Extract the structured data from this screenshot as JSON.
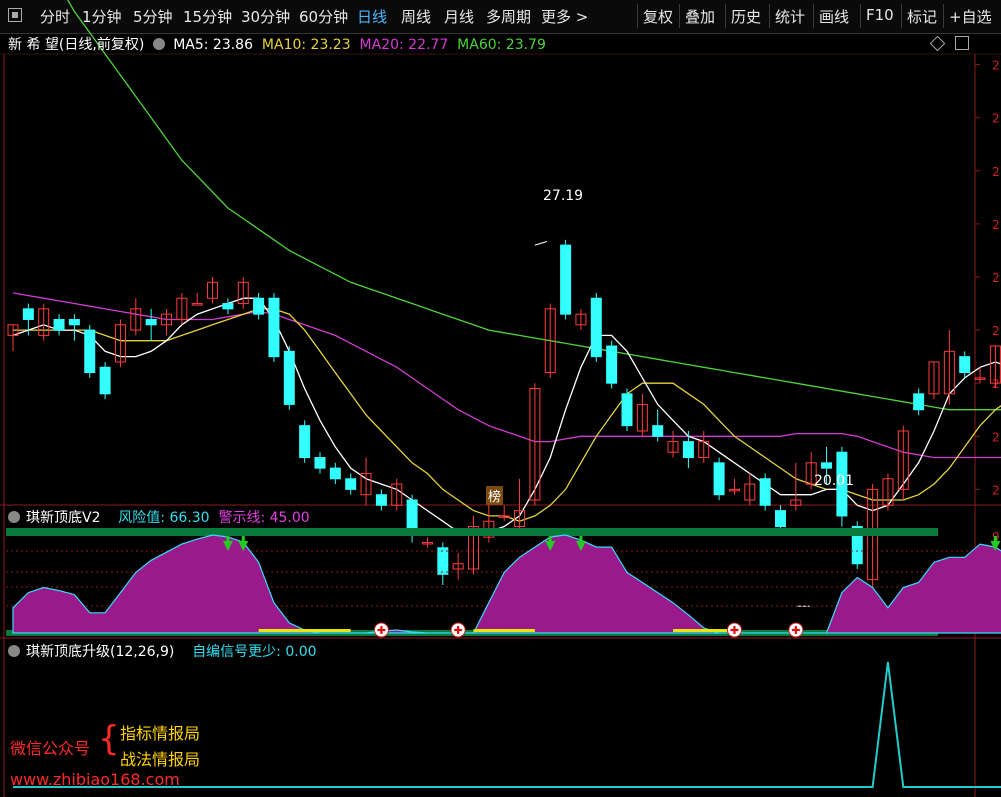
{
  "toolbar": {
    "left": [
      "分时",
      "1分钟",
      "5分钟",
      "15分钟",
      "30分钟",
      "60分钟",
      "日线",
      "周线",
      "月线",
      "多周期",
      "更多 >"
    ],
    "active": "日线",
    "right": [
      "复权",
      "叠加",
      "历史",
      "统计",
      "画线",
      "F10",
      "标记",
      "+自选"
    ]
  },
  "main_panel": {
    "stock": "新 希 望",
    "period": "(日线,前复权)",
    "ma5": "MA5: 23.86",
    "ma10": "MA10: 23.23",
    "ma20": "MA20: 22.77",
    "ma60": "MA60: 23.79",
    "high_label": "27.19",
    "low_label": "20.01",
    "badge": "榜"
  },
  "ind1": {
    "name": "琪新顶底V2",
    "risk": "风险值: 66.30",
    "warn": "警示线: 45.00"
  },
  "ind2": {
    "name": "琪新顶底升级(12,26,9)",
    "signal": "自编信号更少: 0.00"
  },
  "watermark": {
    "wechat": "微信公众号",
    "line1": "指标情报局",
    "line2": "战法情报局",
    "url": "www.zhibiao168.com"
  },
  "colors": {
    "up": "#ff3c3c",
    "down": "#33ffff",
    "ma5": "#ffffff",
    "ma10": "#e6d23c",
    "ma20": "#d23cd2",
    "ma60": "#50d23c",
    "area": "#9a1a8c",
    "band": "#0a7a3a"
  },
  "chart_data": [
    {
      "type": "candlestick",
      "title": "新 希 望",
      "ylim": [
        19.8,
        28.2
      ],
      "candles": [
        [
          22.9,
          23.1,
          22.6,
          22.8
        ],
        [
          23.4,
          23.2,
          23.5,
          22.9
        ],
        [
          22.9,
          23.4,
          22.8,
          23.5
        ],
        [
          23.2,
          23.0,
          23.3,
          22.9
        ],
        [
          23.2,
          23.1,
          23.3,
          22.8
        ],
        [
          23.0,
          22.2,
          23.1,
          22.1
        ],
        [
          22.3,
          21.8,
          22.4,
          21.7
        ],
        [
          22.4,
          23.1,
          22.3,
          23.2
        ],
        [
          23.0,
          23.4,
          22.9,
          23.6
        ],
        [
          23.2,
          23.1,
          23.4,
          22.8
        ],
        [
          23.1,
          23.3,
          22.9,
          23.4
        ],
        [
          23.2,
          23.6,
          23.1,
          23.7
        ],
        [
          23.5,
          23.5,
          23.5,
          23.7
        ],
        [
          23.6,
          23.9,
          23.5,
          24.0
        ],
        [
          23.5,
          23.4,
          23.6,
          23.3
        ],
        [
          23.5,
          23.9,
          23.4,
          24.0
        ],
        [
          23.6,
          23.3,
          23.7,
          23.2
        ],
        [
          23.6,
          22.5,
          23.7,
          22.4
        ],
        [
          22.6,
          21.6,
          22.7,
          21.5
        ],
        [
          21.2,
          20.6,
          21.3,
          20.5
        ],
        [
          20.6,
          20.4,
          20.7,
          20.3
        ],
        [
          20.4,
          20.2,
          20.5,
          20.1
        ],
        [
          20.2,
          20.0,
          20.3,
          19.9
        ],
        [
          19.9,
          20.3,
          19.7,
          20.6
        ],
        [
          19.9,
          19.7,
          20.0,
          19.6
        ],
        [
          19.7,
          20.1,
          19.6,
          20.2
        ],
        [
          19.8,
          19.2,
          19.9,
          19.0
        ],
        [
          19.0,
          19.0,
          19.1,
          18.9
        ],
        [
          18.9,
          18.4,
          19.0,
          18.2
        ],
        [
          18.5,
          18.6,
          18.3,
          18.8
        ],
        [
          18.5,
          19.3,
          18.4,
          19.5
        ],
        [
          19.1,
          19.4,
          19.0,
          19.8
        ],
        [
          19.5,
          19.5,
          19.4,
          19.7
        ],
        [
          19.3,
          19.6,
          19.2,
          20.2
        ],
        [
          19.8,
          21.9,
          19.7,
          22.0
        ],
        [
          22.2,
          23.4,
          22.1,
          23.5
        ],
        [
          24.6,
          23.3,
          24.7,
          23.2
        ],
        [
          23.1,
          23.3,
          23.0,
          23.4
        ],
        [
          23.6,
          22.5,
          23.7,
          22.4
        ],
        [
          22.7,
          22.0,
          22.8,
          21.9
        ],
        [
          21.8,
          21.2,
          21.9,
          21.1
        ],
        [
          21.1,
          21.6,
          21.0,
          21.8
        ],
        [
          21.2,
          21.0,
          21.5,
          20.9
        ],
        [
          20.7,
          20.9,
          20.6,
          21.1
        ],
        [
          20.9,
          20.6,
          21.1,
          20.4
        ],
        [
          20.6,
          20.9,
          20.5,
          21.1
        ],
        [
          20.5,
          19.9,
          20.6,
          19.8
        ],
        [
          20.0,
          20.0,
          20.2,
          19.9
        ],
        [
          19.8,
          20.1,
          19.7,
          20.3
        ],
        [
          20.2,
          19.7,
          20.3,
          19.6
        ],
        [
          19.6,
          19.3,
          19.7,
          19.2
        ],
        [
          19.7,
          19.8,
          19.6,
          20.5
        ],
        [
          20.1,
          20.5,
          20.0,
          20.7
        ],
        [
          20.5,
          20.4,
          20.8,
          20.1
        ],
        [
          20.7,
          19.5,
          20.8,
          19.3
        ],
        [
          19.3,
          18.6,
          19.4,
          18.5
        ],
        [
          18.3,
          20.0,
          17.8,
          20.1
        ],
        [
          19.7,
          20.2,
          19.6,
          20.3
        ],
        [
          20.0,
          21.1,
          19.8,
          21.2
        ],
        [
          21.8,
          21.5,
          21.9,
          21.4
        ],
        [
          21.8,
          22.4,
          21.7,
          22.4
        ],
        [
          21.8,
          22.6,
          21.6,
          23.0
        ],
        [
          22.5,
          22.2,
          22.6,
          22.1
        ],
        [
          22.1,
          22.1,
          22.0,
          22.3
        ],
        [
          22.0,
          22.7,
          21.9,
          22.7
        ],
        [
          22.6,
          21.8,
          22.7,
          21.7
        ]
      ],
      "ma5_line": [
        22.9,
        23.0,
        23.1,
        23.0,
        23.0,
        22.9,
        22.6,
        22.5,
        22.5,
        22.6,
        22.8,
        23.1,
        23.3,
        23.4,
        23.5,
        23.6,
        23.6,
        23.2,
        22.6,
        21.9,
        21.3,
        20.8,
        20.4,
        20.2,
        20.1,
        20.0,
        19.8,
        19.6,
        19.4,
        19.2,
        19.2,
        19.2,
        19.3,
        19.5,
        20.0,
        20.6,
        21.5,
        22.3,
        22.9,
        22.9,
        22.6,
        22.1,
        21.6,
        21.3,
        21.0,
        20.9,
        20.7,
        20.5,
        20.3,
        20.1,
        19.9,
        19.9,
        19.9,
        20.0,
        20.0,
        19.7,
        19.6,
        19.7,
        20.1,
        20.5,
        21.1,
        21.8,
        22.1,
        22.3,
        22.4,
        22.3
      ],
      "ma10_line": [
        23.0,
        23.0,
        23.0,
        23.0,
        23.0,
        23.0,
        22.9,
        22.8,
        22.8,
        22.8,
        22.8,
        22.9,
        23.0,
        23.1,
        23.2,
        23.3,
        23.4,
        23.4,
        23.3,
        23.0,
        22.6,
        22.2,
        21.8,
        21.4,
        21.1,
        20.8,
        20.5,
        20.3,
        20.0,
        19.8,
        19.6,
        19.5,
        19.5,
        19.4,
        19.5,
        19.7,
        20.0,
        20.5,
        21.0,
        21.4,
        21.8,
        22.0,
        22.0,
        22.0,
        21.8,
        21.6,
        21.3,
        21.0,
        20.8,
        20.6,
        20.4,
        20.2,
        20.1,
        20.0,
        20.0,
        19.9,
        19.8,
        19.8,
        19.8,
        19.9,
        20.1,
        20.4,
        20.8,
        21.2,
        21.5,
        21.7
      ],
      "ma20_line": [
        23.7,
        23.65,
        23.6,
        23.55,
        23.5,
        23.45,
        23.4,
        23.35,
        23.3,
        23.25,
        23.2,
        23.2,
        23.2,
        23.2,
        23.25,
        23.3,
        23.35,
        23.3,
        23.2,
        23.1,
        23.0,
        22.9,
        22.75,
        22.6,
        22.45,
        22.3,
        22.1,
        21.9,
        21.7,
        21.5,
        21.35,
        21.2,
        21.1,
        21.0,
        20.9,
        20.9,
        20.95,
        21.0,
        21.0,
        21.0,
        21.0,
        21.0,
        21.0,
        21.0,
        21.0,
        21.0,
        21.0,
        21.0,
        21.0,
        21.0,
        21.0,
        21.05,
        21.05,
        21.05,
        21.05,
        21.0,
        20.9,
        20.8,
        20.7,
        20.65,
        20.6,
        20.6,
        20.6,
        20.6,
        20.6,
        20.6
      ],
      "ma60_line": [
        31.0,
        30.5,
        30.0,
        29.5,
        29.0,
        28.6,
        28.2,
        27.8,
        27.4,
        27.0,
        26.6,
        26.2,
        25.9,
        25.6,
        25.3,
        25.1,
        24.9,
        24.7,
        24.5,
        24.35,
        24.2,
        24.05,
        23.9,
        23.8,
        23.7,
        23.6,
        23.5,
        23.4,
        23.3,
        23.2,
        23.1,
        23.0,
        22.95,
        22.9,
        22.85,
        22.8,
        22.75,
        22.7,
        22.65,
        22.6,
        22.55,
        22.5,
        22.45,
        22.4,
        22.35,
        22.3,
        22.25,
        22.2,
        22.15,
        22.1,
        22.05,
        22.0,
        21.95,
        21.9,
        21.85,
        21.8,
        21.75,
        21.7,
        21.65,
        21.6,
        21.55,
        21.5,
        21.5,
        21.5,
        21.5,
        21.5
      ]
    },
    {
      "type": "area",
      "title": "琪新顶底V2",
      "ylim": [
        0,
        10
      ],
      "warn_line": 4.5,
      "values": [
        2.5,
        4.0,
        4.5,
        4.2,
        3.8,
        2.0,
        2.0,
        4.0,
        6.0,
        7.2,
        8.0,
        8.8,
        9.3,
        9.7,
        9.5,
        9.0,
        7.0,
        3.0,
        1.0,
        0.3,
        0.0,
        0.0,
        0.0,
        0.0,
        0.2,
        0.3,
        0.1,
        0.0,
        0.0,
        0.0,
        0.0,
        3.0,
        6.0,
        7.5,
        8.5,
        9.5,
        9.7,
        9.2,
        8.5,
        8.5,
        6.0,
        5.0,
        4.0,
        3.0,
        1.8,
        0.5,
        0.0,
        0.0,
        0.0,
        0.0,
        0.0,
        0.0,
        0.0,
        0.0,
        4.0,
        5.5,
        4.5,
        2.5,
        4.5,
        5.0,
        7.0,
        7.5,
        7.5,
        8.8,
        8.5,
        7.5
      ],
      "top_signals": [
        14,
        15,
        35,
        37,
        64
      ],
      "bottom_signals": [
        24,
        29,
        47,
        51
      ]
    },
    {
      "type": "line",
      "title": "琪新顶底升级(12,26,9)",
      "ylim": [
        0,
        1
      ],
      "values": [
        0,
        0,
        0,
        0,
        0,
        0,
        0,
        0,
        0,
        0,
        0,
        0,
        0,
        0,
        0,
        0,
        0,
        0,
        0,
        0,
        0,
        0,
        0,
        0,
        0,
        0,
        0,
        0,
        0,
        0,
        0,
        0,
        0,
        0,
        0,
        0,
        0,
        0,
        0,
        0,
        0,
        0,
        0,
        0,
        0,
        0,
        0,
        0,
        0,
        0,
        0,
        0,
        0,
        0,
        0,
        0,
        0,
        1,
        0,
        0,
        0,
        0,
        0,
        0,
        0,
        0
      ]
    }
  ]
}
